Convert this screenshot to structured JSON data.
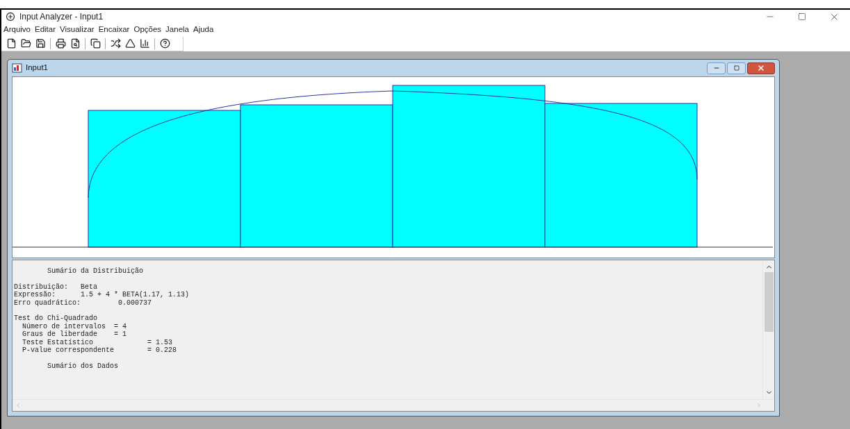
{
  "window": {
    "title": "Input Analyzer - Input1"
  },
  "menu": [
    {
      "label": "Arquivo"
    },
    {
      "label": "Editar"
    },
    {
      "label": "Visualizar"
    },
    {
      "label": "Encaixar"
    },
    {
      "label": "Opções"
    },
    {
      "label": "Janela"
    },
    {
      "label": "Ajuda"
    }
  ],
  "child_window": {
    "title": "Input1"
  },
  "report": [
    [
      "        Sumário da Distribuição"
    ],
    [
      "Distribuição:   Beta",
      "Expressão:      1.5 + 4 * BETA(1.17, 1.13)",
      "Erro quadrático:         0.000737"
    ],
    [
      "Test do Chi-Quadrado",
      "  Número de intervalos  = 4",
      "  Graus de liberdade    = 1",
      "  Teste Estatístico             = 1.53",
      "  P-value correspondente        = 0.228"
    ],
    [
      "        Sumário dos Dados"
    ]
  ]
}
